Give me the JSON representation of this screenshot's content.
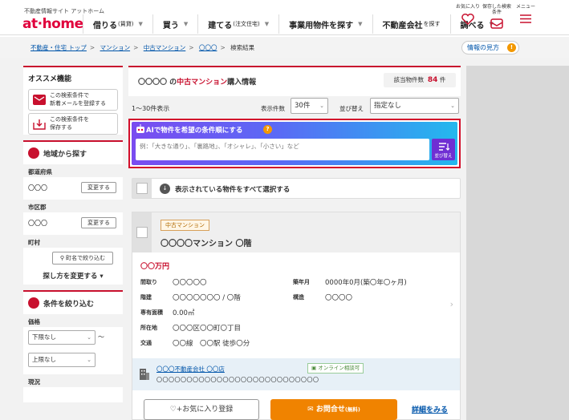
{
  "header": {
    "site_sub": "不動産情報サイト アットホーム",
    "logo": "at home",
    "nav": [
      {
        "label": "借りる",
        "small": "(賃貸)"
      },
      {
        "label": "買う",
        "small": ""
      },
      {
        "label": "建てる",
        "small": "(注文住宅)"
      },
      {
        "label": "事業用物件を探す",
        "small": ""
      },
      {
        "label": "不動産会社",
        "small": "を探す"
      },
      {
        "label": "調べる",
        "small": ""
      }
    ],
    "icons": [
      {
        "label": "お気に入り",
        "icon": "heart-icon"
      },
      {
        "label": "保存した検索条件",
        "icon": "mail-icon"
      },
      {
        "label": "メニュー",
        "icon": "menu-icon"
      }
    ]
  },
  "breadcrumb": {
    "items": [
      "不動産・住宅 トップ",
      "マンション",
      "中古マンション",
      "〇〇〇",
      "検索結果"
    ]
  },
  "help_link": "情報の見方",
  "sidebar": {
    "recommend_title": "オススメ機能",
    "recommend_buttons": [
      {
        "line1": "この検索条件で",
        "line2": "新着メールを登録する",
        "icon": "mail-icon"
      },
      {
        "line1": "この検索条件を",
        "line2": "保存する",
        "icon": "save-icon"
      }
    ],
    "area_title": "地域から探す",
    "prefecture_label": "都道府県",
    "prefecture_value": "〇〇〇",
    "change_label": "変更する",
    "city_label": "市区郡",
    "city_value": "〇〇〇",
    "town_label": "町村",
    "town_button": "町名で絞り込む",
    "how_change": "探し方を変更する",
    "filter_title": "条件を絞り込む",
    "price_label": "価格",
    "price_min": "下限なし",
    "price_tilde": "〜",
    "price_max": "上限なし",
    "status_label": "現況"
  },
  "main": {
    "title_prefix": "〇〇〇〇 の",
    "title_em": "中古マンション",
    "title_suffix": "購入情報",
    "count_label": "該当物件数",
    "count_value": "84",
    "count_unit": "件",
    "range_text": "1〜30件表示",
    "per_page_label": "表示件数",
    "per_page_value": "30件",
    "sort_label": "並び替え",
    "sort_value": "指定なし",
    "ai_title": "AIで物件を希望の条件順にする",
    "ai_help": "?",
    "ai_placeholder": "例：「大きな通り」、「裏路地」、「オシャレ」、「小さい」など",
    "ai_button": "並び替え",
    "select_all": "表示されている物件をすべて選択する"
  },
  "property": {
    "badge": "中古マンション",
    "name": "〇〇〇〇マンション 〇階",
    "price": "〇〇万円",
    "details": [
      {
        "k": "間取り",
        "v": "〇〇〇〇〇"
      },
      {
        "k": "築年月",
        "v": "0000年0月(築〇年〇ヶ月)"
      },
      {
        "k": "階建",
        "v": "〇〇〇〇〇〇〇 / 〇階"
      },
      {
        "k": "構造",
        "v": "〇〇〇〇"
      },
      {
        "k": "専有面積",
        "v": "0.00㎡"
      },
      {
        "k": "所在地",
        "v": "〇〇〇区〇〇町〇丁目"
      },
      {
        "k": "交通",
        "v": "〇〇線　〇〇駅 徒歩〇分"
      }
    ],
    "agent_name": "〇〇〇不動産会社 〇〇店",
    "agent_addr": "〇〇〇〇〇〇〇〇〇〇〇〇〇〇〇〇〇〇〇〇〇〇〇〇〇〇〇",
    "online": "オンライン相談可",
    "fav_button": "お気に入り登録",
    "inquiry_button": "お問合せ",
    "inquiry_small": "(無料)",
    "detail_link": "詳細をみる"
  },
  "colors": {
    "brand": "#e0003c",
    "accent": "#c8102e",
    "inquiry": "#f08300",
    "ai_from": "#7a4cf0",
    "ai_to": "#23b8ee"
  }
}
